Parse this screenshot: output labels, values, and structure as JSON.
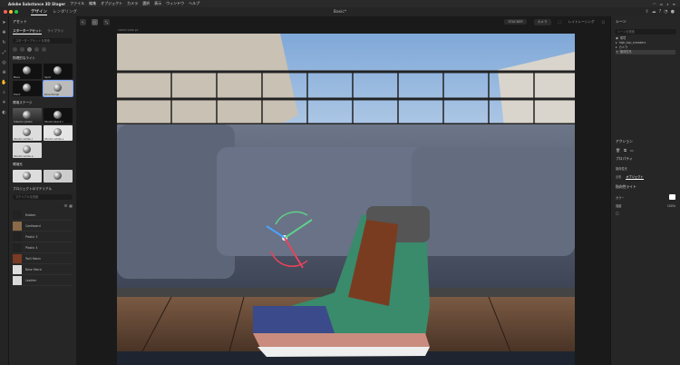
{
  "menubar": {
    "app_name": "Adobe Substance 3D Stager",
    "items": [
      "ファイル",
      "編集",
      "オブジェクト",
      "カメラ",
      "選択",
      "表示",
      "ウィンドウ",
      "ヘルプ"
    ]
  },
  "app": {
    "modes": [
      "デザイン",
      "レンダリング"
    ],
    "doc_title": "Basic*"
  },
  "left_panel": {
    "title": "アセット",
    "tabs": [
      "スターターアセット",
      "ライブラリ"
    ],
    "search_placeholder": "スターターアセットを検索",
    "sections": {
      "lights": {
        "title": "物理的なライト",
        "items": [
          "Bare",
          "Spot",
          "Point",
          "Directional"
        ]
      },
      "env": {
        "title": "環境ステージ",
        "items": [
          "Interior photo",
          "Studio black c",
          "Studio white c",
          "Studio white s",
          "Studio white a"
        ]
      },
      "envlight": {
        "title": "環境光",
        "items": [
          "",
          ""
        ]
      },
      "materials": {
        "title": "プロジェクトのマテリアル",
        "search_placeholder": "マテリアルを検索",
        "items": [
          "Rubber",
          "Cardboard",
          "Plastic 3",
          "Plastic 4",
          "Twill Fabric",
          "Base Fabric",
          "Leather"
        ]
      }
    }
  },
  "viewport": {
    "canvas_size": "1920×1440 px",
    "unit_select": "STACKER",
    "camera_select": "カメラ",
    "render_button": "レイトレーシング",
    "scene_description": ""
  },
  "right_panel": {
    "title": "シーン",
    "search_placeholder": "シーンを検索",
    "scene_items": [
      "環境",
      "high_top_sneakers",
      "カメラ",
      "指向性光"
    ],
    "actions_title": "アクション",
    "properties_title": "プロパティ",
    "prop_object_label": "指向性光",
    "prop_tabs": [
      "全般",
      "オブジェクト"
    ],
    "light_title": "指向性ライト",
    "color_label": "カラー",
    "intensity_label": "強度",
    "intensity_value": "100%"
  },
  "colors": {
    "accent": "#7aa6ff",
    "panel": "#262626",
    "gizmo_red": "#e8445c",
    "gizmo_green": "#5fd08a",
    "gizmo_blue": "#4aa3ff"
  }
}
